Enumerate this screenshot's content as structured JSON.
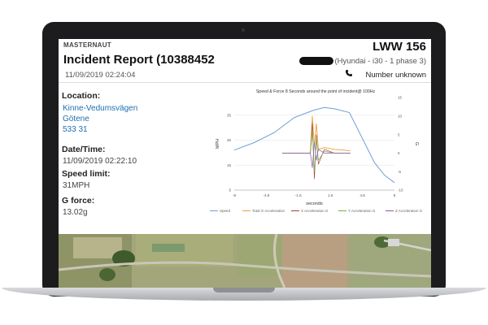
{
  "report": {
    "brand": "MASTERNAUT",
    "registration": "LWW 156",
    "title": "Incident Report (10388452",
    "vehicle": "(Hyundai - i30 - 1 phase 3)",
    "timestamp": "11/09/2019 02:24:04",
    "phone": "Number unknown"
  },
  "details": {
    "location_label": "Location:",
    "location_street": "Kinne-Vedumsvägen",
    "location_city": "Götene",
    "location_postcode": "533 31",
    "datetime_label": "Date/Time:",
    "datetime_value": "11/09/2019 02:22:10",
    "speed_limit_label": "Speed limit:",
    "speed_limit_value": "31MPH",
    "gforce_label": "G force:",
    "gforce_value": "13.02g"
  },
  "colors": {
    "speed": "#6fa0d8",
    "total_g": "#e8a23a",
    "x_acc": "#b23a3a",
    "y_acc": "#6fb04a",
    "z_acc": "#8a5aa8",
    "link": "#1f6fb2",
    "bezel": "#1c1c1e"
  },
  "chart_data": {
    "type": "line",
    "title": "Speed & Force 8 Seconds around the point of incident@ 100Hz",
    "xlabel": "seconds",
    "ylabel": "MPH",
    "y2label": "G",
    "xlim": [
      -8,
      8
    ],
    "ylim": [
      5,
      42
    ],
    "y2lim": [
      -10,
      15
    ],
    "x_ticks": [
      "-8",
      "-4.8",
      "-1.6",
      "1.6",
      "4.8",
      "8"
    ],
    "y_ticks": [
      "5",
      "15",
      "25",
      "35"
    ],
    "y2_ticks": [
      "-10",
      "-5",
      "0",
      "5",
      "10",
      "15"
    ],
    "grid": true,
    "legend_position": "bottom",
    "series": [
      {
        "name": "Speed",
        "axis": "left",
        "x": [
          -8,
          -6,
          -4,
          -2,
          0,
          1,
          2,
          3.5,
          5,
          6,
          7,
          8
        ],
        "values": [
          21,
          24,
          28,
          34,
          37,
          38,
          37.5,
          36,
          24,
          16,
          11,
          8
        ]
      },
      {
        "name": "Total G Acceleration",
        "axis": "right",
        "x": [
          -3.2,
          -0.4,
          -0.2,
          0,
          0.2,
          0.4,
          1,
          2,
          3,
          3.6
        ],
        "values": [
          0,
          0,
          10,
          2,
          8,
          1,
          1.5,
          1,
          0.8,
          0.6
        ]
      },
      {
        "name": "X Acceleration G",
        "axis": "right",
        "x": [
          -3.2,
          -0.4,
          -0.2,
          0,
          0.2,
          0.4,
          1,
          2,
          3,
          3.6
        ],
        "values": [
          0,
          0,
          8,
          -7,
          5,
          -3,
          1,
          0,
          0,
          0
        ]
      },
      {
        "name": "Y Acceleration G",
        "axis": "right",
        "x": [
          -3.2,
          -0.4,
          -0.2,
          0,
          0.2,
          0.4,
          1,
          2,
          3,
          3.6
        ],
        "values": [
          0,
          0,
          6,
          -5,
          4,
          -2,
          0.5,
          0,
          0,
          0
        ]
      },
      {
        "name": "Z Acceleration G",
        "axis": "right",
        "x": [
          -3.2,
          -0.4,
          -0.2,
          0,
          0.2,
          0.4,
          1,
          2,
          3,
          3.6
        ],
        "values": [
          0,
          0,
          -4,
          3,
          -2,
          1,
          0,
          0,
          0,
          0
        ]
      }
    ]
  }
}
